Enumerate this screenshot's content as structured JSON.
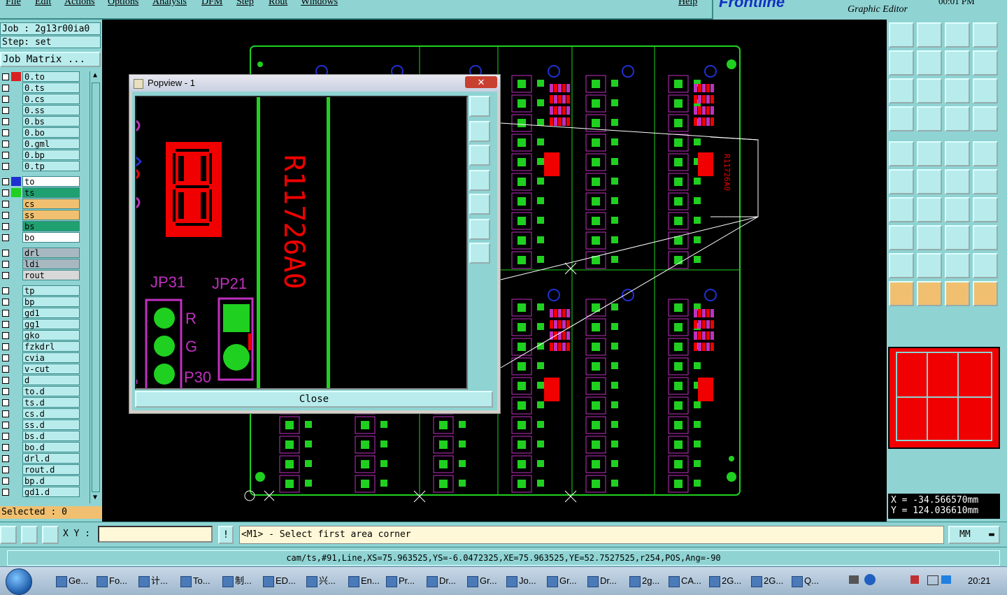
{
  "menu": [
    "File",
    "Edit",
    "Actions",
    "Options",
    "Analysis",
    "DFM",
    "Step",
    "Rout",
    "Windows",
    "Help"
  ],
  "brand": {
    "logo": "Frontline",
    "subtitle": "Graphic Editor",
    "time": "00:01 PM"
  },
  "job": {
    "job_line": "Job : 2g13r00ia0",
    "step_line": "Step: set",
    "matrix_button": "Job Matrix ..."
  },
  "layers": [
    {
      "name": "0.to",
      "color": "#d82020",
      "extra": "#2030d0"
    },
    {
      "name": "0.ts",
      "color": ""
    },
    {
      "name": "0.cs",
      "color": ""
    },
    {
      "name": "0.ss",
      "color": ""
    },
    {
      "name": "0.bs",
      "color": ""
    },
    {
      "name": "0.bo",
      "color": ""
    },
    {
      "name": "0.gml",
      "color": ""
    },
    {
      "name": "0.bp",
      "color": ""
    },
    {
      "name": "0.tp",
      "color": ""
    },
    {
      "name": "to",
      "color": "#2030d0",
      "bg": "#ffffff"
    },
    {
      "name": "ts",
      "color": "#20d020",
      "bg": "#20a070"
    },
    {
      "name": "cs",
      "color": "",
      "bg": "#f0c070"
    },
    {
      "name": "ss",
      "color": "",
      "bg": "#f0c070"
    },
    {
      "name": "bs",
      "color": "",
      "bg": "#20a070"
    },
    {
      "name": "bo",
      "color": "",
      "bg": "#ffffff"
    },
    {
      "name": "drl",
      "color": "",
      "bg": "#a8b8c0"
    },
    {
      "name": "ldi",
      "color": "",
      "bg": "#a8b8c0"
    },
    {
      "name": "rout",
      "color": "",
      "bg": "#d8d8d8"
    },
    {
      "name": "tp",
      "color": ""
    },
    {
      "name": "bp",
      "color": ""
    },
    {
      "name": "gd1",
      "color": ""
    },
    {
      "name": "gg1",
      "color": ""
    },
    {
      "name": "gko",
      "color": ""
    },
    {
      "name": "fzkdrl",
      "color": ""
    },
    {
      "name": "cvia",
      "color": ""
    },
    {
      "name": "v-cut",
      "color": ""
    },
    {
      "name": "d",
      "color": ""
    },
    {
      "name": "to.d",
      "color": ""
    },
    {
      "name": "ts.d",
      "color": ""
    },
    {
      "name": "cs.d",
      "color": ""
    },
    {
      "name": "ss.d",
      "color": ""
    },
    {
      "name": "bs.d",
      "color": ""
    },
    {
      "name": "bo.d",
      "color": ""
    },
    {
      "name": "drl.d",
      "color": ""
    },
    {
      "name": "rout.d",
      "color": ""
    },
    {
      "name": "bp.d",
      "color": ""
    },
    {
      "name": "gd1.d",
      "color": ""
    }
  ],
  "selected": "Selected : 0",
  "popview": {
    "title": "Popview - 1",
    "close": "Close",
    "silk_text": "R11726A0",
    "jp31": "JP31",
    "jp21": "JP21",
    "labels": [
      "R",
      "G",
      "P30"
    ]
  },
  "pcb_part_label": "R11726A0",
  "coords": {
    "x": "X = -34.566570mm",
    "y": "Y = 124.036610mm"
  },
  "command": {
    "xy_label": "X Y :",
    "xy_value": "",
    "prompt": "<M1> - Select first area corner",
    "units": "MM"
  },
  "status": "cam/ts,#91,Line,XS=75.963525,YS=-6.0472325,XE=75.963525,YE=52.7527525,r254,POS,Ang=-90",
  "taskbar": {
    "tasks": [
      "Ge...",
      "Fo...",
      "计...",
      "To...",
      "制...",
      "ED...",
      "兴...",
      "En...",
      "Pr...",
      "Dr...",
      "Gr...",
      "Jo...",
      "Gr...",
      "Dr...",
      "2g...",
      "CA...",
      "2G...",
      "2G...",
      "Q..."
    ],
    "clock": "20:21"
  },
  "colors": {
    "panel": "#8fd3d3",
    "copper": "#20d020",
    "silk": "#c030c0",
    "accent_red": "#f00000",
    "highlight_yellow": "#f0c070"
  }
}
